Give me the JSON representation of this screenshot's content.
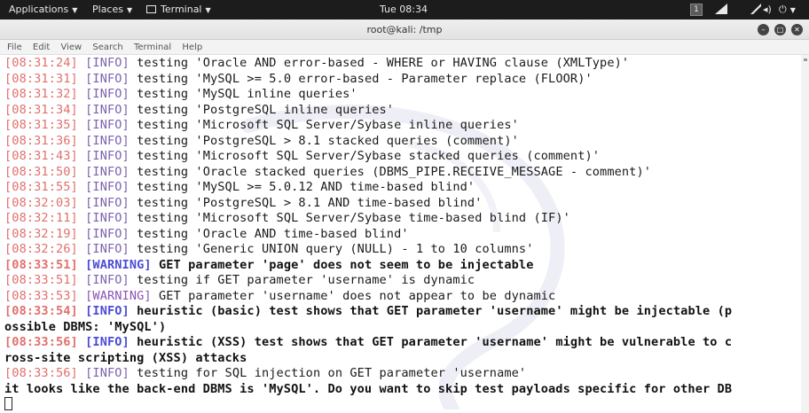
{
  "topbar": {
    "applications": "Applications",
    "places": "Places",
    "terminal": "Terminal",
    "clock": "Tue 08:34",
    "workspace": "1",
    "icons": [
      "chevron-down-icon",
      "terminal-icon",
      "workspace-indicator",
      "network-icon",
      "volume-icon",
      "power-icon"
    ]
  },
  "window": {
    "title": "root@kali: /tmp",
    "controls": [
      "minimize-icon",
      "maximize-icon",
      "close-icon"
    ]
  },
  "menu": {
    "items": [
      "File",
      "Edit",
      "View",
      "Search",
      "Terminal",
      "Help"
    ]
  },
  "colors": {
    "timestamp": "#e0706c",
    "info_tag": "#7c62b0",
    "warning_tag": "#8a54b8",
    "bold_tag": "#4b4bd6",
    "panel": "#1c1c1c"
  },
  "terminal": {
    "lines": [
      {
        "ts": "[08:31:24]",
        "tag": "[INFO]",
        "text": " testing 'Oracle AND error-based - WHERE or HAVING clause (XMLType)'",
        "bold": false
      },
      {
        "ts": "[08:31:31]",
        "tag": "[INFO]",
        "text": " testing 'MySQL >= 5.0 error-based - Parameter replace (FLOOR)'",
        "bold": false
      },
      {
        "ts": "[08:31:32]",
        "tag": "[INFO]",
        "text": " testing 'MySQL inline queries'",
        "bold": false
      },
      {
        "ts": "[08:31:34]",
        "tag": "[INFO]",
        "text": " testing 'PostgreSQL inline queries'",
        "bold": false
      },
      {
        "ts": "[08:31:35]",
        "tag": "[INFO]",
        "text": " testing 'Microsoft SQL Server/Sybase inline queries'",
        "bold": false
      },
      {
        "ts": "[08:31:36]",
        "tag": "[INFO]",
        "text": " testing 'PostgreSQL > 8.1 stacked queries (comment)'",
        "bold": false
      },
      {
        "ts": "[08:31:43]",
        "tag": "[INFO]",
        "text": " testing 'Microsoft SQL Server/Sybase stacked queries (comment)'",
        "bold": false
      },
      {
        "ts": "[08:31:50]",
        "tag": "[INFO]",
        "text": " testing 'Oracle stacked queries (DBMS_PIPE.RECEIVE_MESSAGE - comment)'",
        "bold": false
      },
      {
        "ts": "[08:31:55]",
        "tag": "[INFO]",
        "text": " testing 'MySQL >= 5.0.12 AND time-based blind'",
        "bold": false
      },
      {
        "ts": "[08:32:03]",
        "tag": "[INFO]",
        "text": " testing 'PostgreSQL > 8.1 AND time-based blind'",
        "bold": false
      },
      {
        "ts": "[08:32:11]",
        "tag": "[INFO]",
        "text": " testing 'Microsoft SQL Server/Sybase time-based blind (IF)'",
        "bold": false
      },
      {
        "ts": "[08:32:19]",
        "tag": "[INFO]",
        "text": " testing 'Oracle AND time-based blind'",
        "bold": false
      },
      {
        "ts": "[08:32:26]",
        "tag": "[INFO]",
        "text": " testing 'Generic UNION query (NULL) - 1 to 10 columns'",
        "bold": false
      },
      {
        "ts": "[08:33:51]",
        "tag": "[WARNING]",
        "text": " GET parameter 'page' does not seem to be injectable",
        "bold": true
      },
      {
        "ts": "[08:33:51]",
        "tag": "[INFO]",
        "text": " testing if GET parameter 'username' is dynamic",
        "bold": false
      },
      {
        "ts": "[08:33:53]",
        "tag": "[WARNING]",
        "text": " GET parameter 'username' does not appear to be dynamic",
        "bold": false
      },
      {
        "ts": "[08:33:54]",
        "tag": "[INFO]",
        "text": " heuristic (basic) test shows that GET parameter 'username' might be injectable (p",
        "bold": true
      },
      {
        "ts": "",
        "tag": "",
        "text": "ossible DBMS: 'MySQL')",
        "bold": true
      },
      {
        "ts": "[08:33:56]",
        "tag": "[INFO]",
        "text": " heuristic (XSS) test shows that GET parameter 'username' might be vulnerable to c",
        "bold": true
      },
      {
        "ts": "",
        "tag": "",
        "text": "ross-site scripting (XSS) attacks",
        "bold": true
      },
      {
        "ts": "[08:33:56]",
        "tag": "[INFO]",
        "text": " testing for SQL injection on GET parameter 'username'",
        "bold": false
      },
      {
        "ts": "",
        "tag": "",
        "text": "it looks like the back-end DBMS is 'MySQL'. Do you want to skip test payloads specific for other DB",
        "bold": true
      }
    ]
  }
}
